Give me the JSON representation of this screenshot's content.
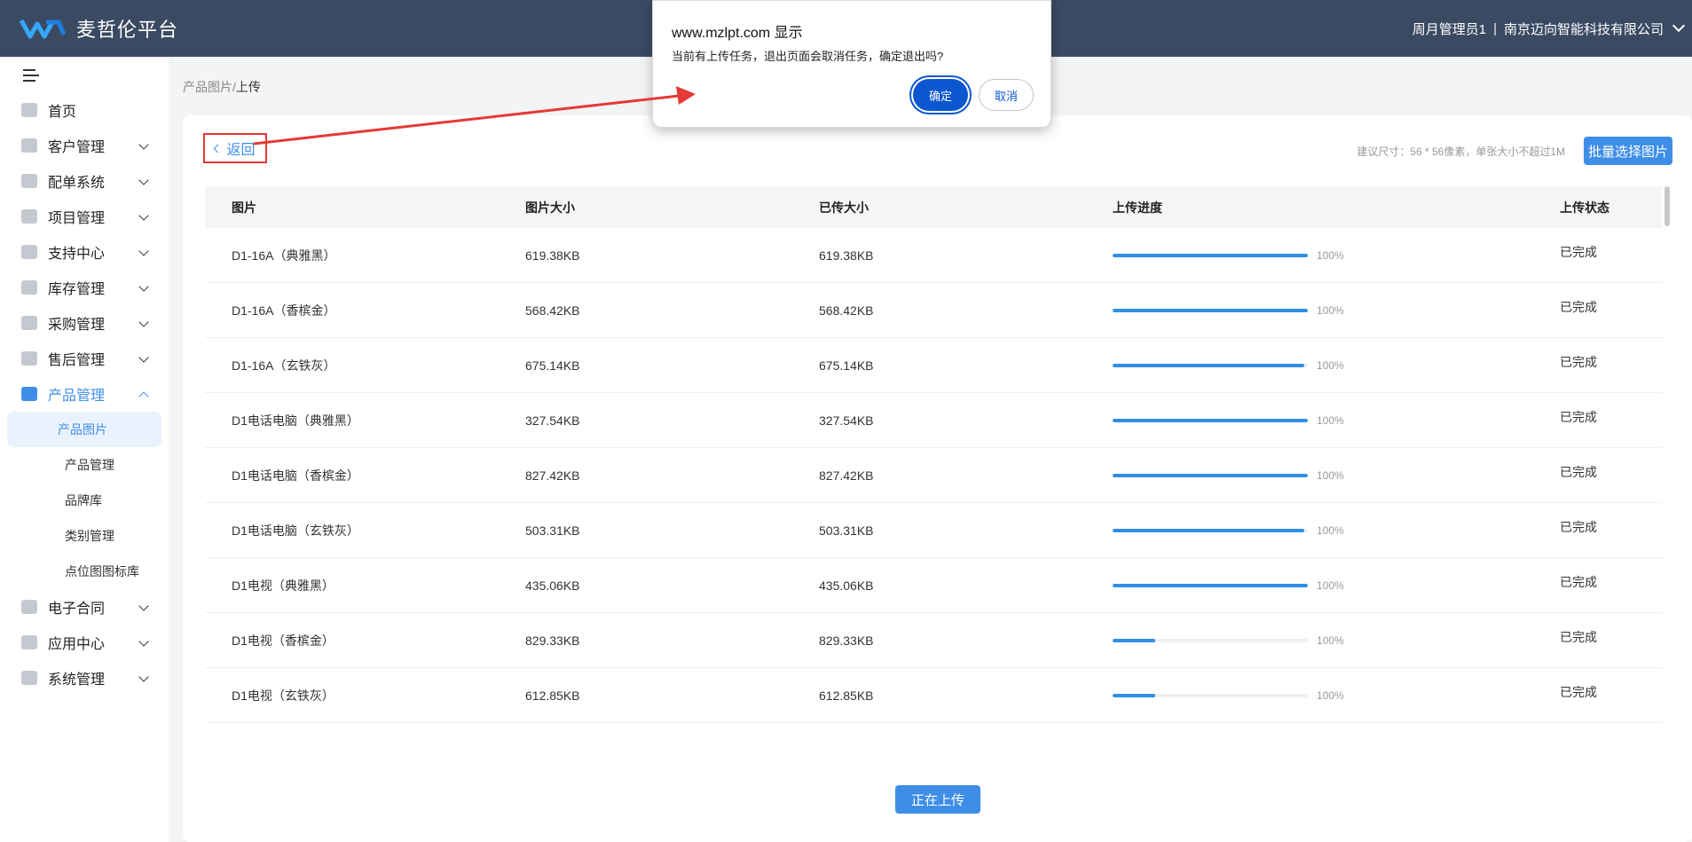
{
  "header": {
    "app_title": "麦哲伦平台",
    "user_name": "周月管理员1",
    "separator": "|",
    "company": "南京迈向智能科技有限公司"
  },
  "sidebar": {
    "items": [
      {
        "label": "首页",
        "icon": "home-icon"
      },
      {
        "label": "客户管理",
        "icon": "customer-icon"
      },
      {
        "label": "配单系统",
        "icon": "order-icon"
      },
      {
        "label": "项目管理",
        "icon": "folder-icon"
      },
      {
        "label": "支持中心",
        "icon": "wrench-icon"
      },
      {
        "label": "库存管理",
        "icon": "inventory-icon"
      },
      {
        "label": "采购管理",
        "icon": "cart-icon"
      },
      {
        "label": "售后管理",
        "icon": "headset-icon"
      },
      {
        "label": "产品管理",
        "icon": "product-icon"
      },
      {
        "label": "电子合同",
        "icon": "contract-icon"
      },
      {
        "label": "应用中心",
        "icon": "apps-icon"
      },
      {
        "label": "系统管理",
        "icon": "settings-icon"
      }
    ],
    "sub_items": [
      "产品图片",
      "产品管理",
      "品牌库",
      "类别管理",
      "点位图图标库"
    ]
  },
  "breadcrumb": {
    "parent": "产品图片",
    "sep": "/",
    "current": "上传"
  },
  "main": {
    "back_label": "返回",
    "hint": "建议尺寸：56 * 56像素，单张大小不超过1M",
    "batch_button": "批量选择图片",
    "uploading_button": "正在上传"
  },
  "table": {
    "headers": [
      "图片",
      "图片大小",
      "已传大小",
      "上传进度",
      "上传状态"
    ],
    "rows": [
      {
        "name": "D1-16A（典雅黑）",
        "size": "619.38KB",
        "uploaded": "619.38KB",
        "progress": 1.0,
        "pct": "100%",
        "status": "已完成"
      },
      {
        "name": "D1-16A（香槟金）",
        "size": "568.42KB",
        "uploaded": "568.42KB",
        "progress": 1.0,
        "pct": "100%",
        "status": "已完成"
      },
      {
        "name": "D1-16A（玄铁灰）",
        "size": "675.14KB",
        "uploaded": "675.14KB",
        "progress": 0.98,
        "pct": "100%",
        "status": "已完成"
      },
      {
        "name": "D1电话电脑（典雅黑）",
        "size": "327.54KB",
        "uploaded": "327.54KB",
        "progress": 1.0,
        "pct": "100%",
        "status": "已完成"
      },
      {
        "name": "D1电话电脑（香槟金）",
        "size": "827.42KB",
        "uploaded": "827.42KB",
        "progress": 1.0,
        "pct": "100%",
        "status": "已完成"
      },
      {
        "name": "D1电话电脑（玄铁灰）",
        "size": "503.31KB",
        "uploaded": "503.31KB",
        "progress": 0.98,
        "pct": "100%",
        "status": "已完成"
      },
      {
        "name": "D1电视（典雅黑）",
        "size": "435.06KB",
        "uploaded": "435.06KB",
        "progress": 1.0,
        "pct": "100%",
        "status": "已完成"
      },
      {
        "name": "D1电视（香槟金）",
        "size": "829.33KB",
        "uploaded": "829.33KB",
        "progress": 0.22,
        "pct": "100%",
        "status": "已完成"
      },
      {
        "name": "D1电视（玄铁灰）",
        "size": "612.85KB",
        "uploaded": "612.85KB",
        "progress": 0.22,
        "pct": "100%",
        "status": "已完成"
      }
    ]
  },
  "dialog": {
    "title": "www.mzlpt.com 显示",
    "message": "当前有上传任务，退出页面会取消任务，确定退出吗?",
    "ok": "确定",
    "cancel": "取消"
  },
  "colors": {
    "header_bg": "#3a4a63",
    "accent": "#3e8ee8",
    "progress": "#2f8fe6",
    "annotation": "#e53935",
    "dialog_primary": "#0b57d0"
  }
}
